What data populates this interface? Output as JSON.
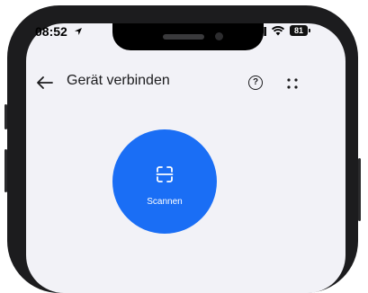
{
  "status_bar": {
    "time": "08:52",
    "battery": "81",
    "icons": [
      "location-arrow-icon",
      "signal-icon",
      "wifi-icon",
      "battery-icon"
    ]
  },
  "header": {
    "title": "Gerät verbinden",
    "icons": [
      "back-arrow-icon",
      "help-icon",
      "more-icon"
    ],
    "help_glyph": "?"
  },
  "scan": {
    "label": "Scannen",
    "icon": "scan-icon",
    "accent_color": "#1a6ef5"
  },
  "colors": {
    "screen_background": "#f2f2f7",
    "frame": "#1c1c1e"
  }
}
